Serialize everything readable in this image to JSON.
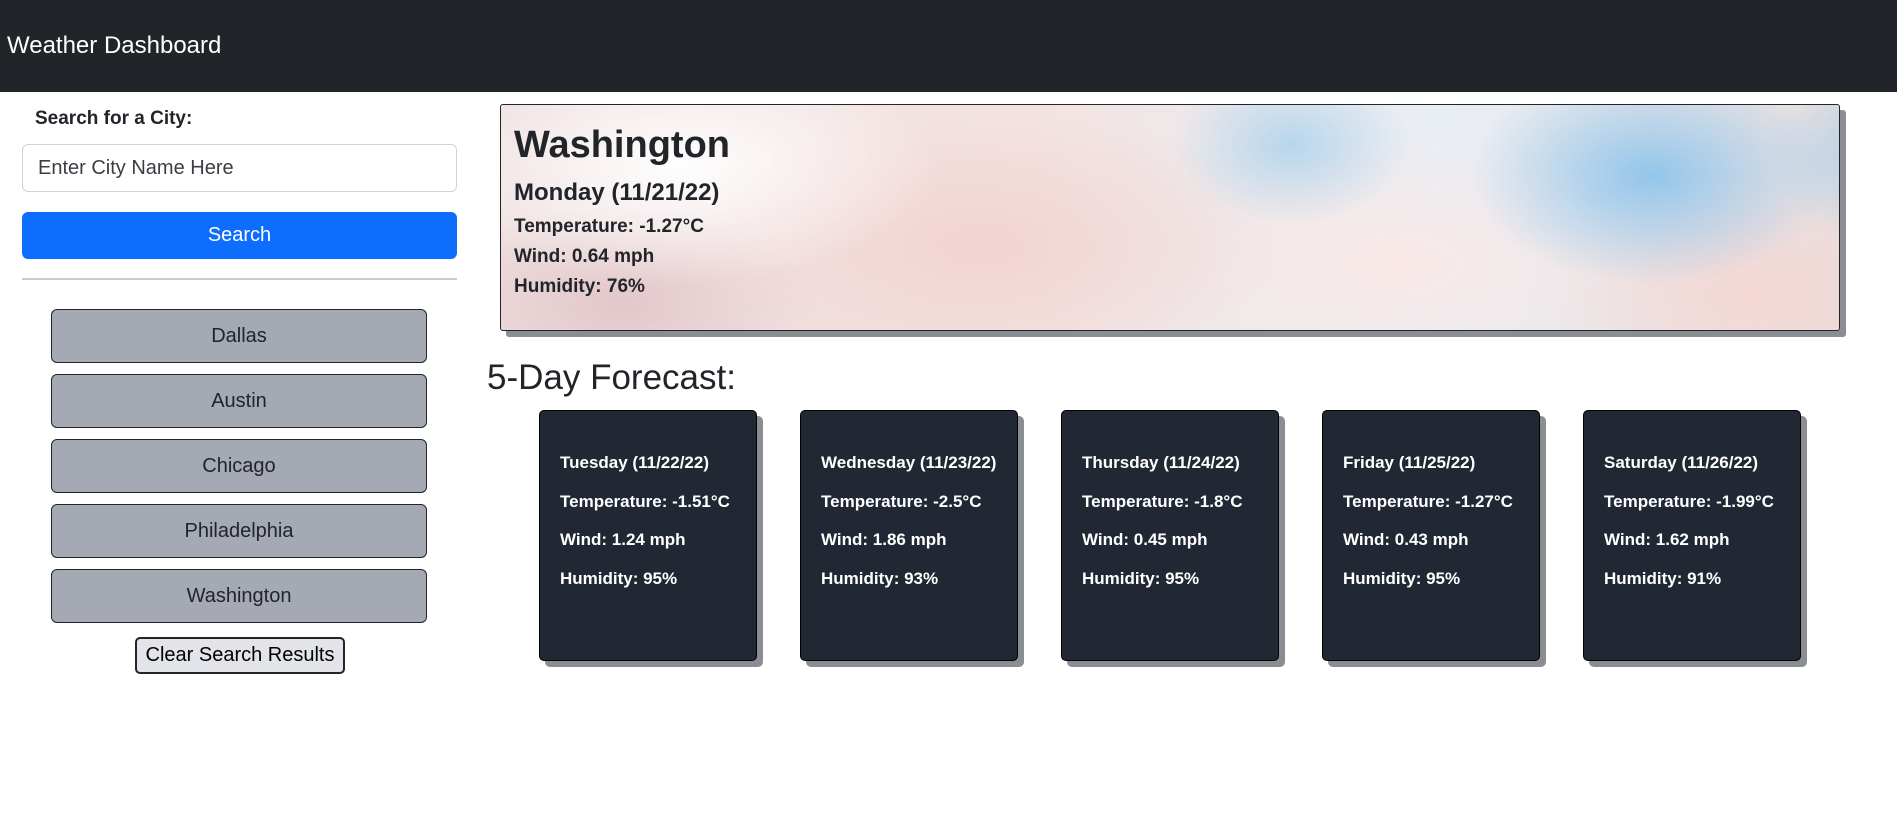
{
  "navbar": {
    "title": "Weather Dashboard"
  },
  "sidebar": {
    "search_label": "Search for a City:",
    "search_placeholder": "Enter City Name Here",
    "search_button": "Search",
    "history": [
      "Dallas",
      "Austin",
      "Chicago",
      "Philadelphia",
      "Washington"
    ],
    "clear_button": "Clear Search Results"
  },
  "current": {
    "city": "Washington",
    "date": "Monday (11/21/22)",
    "temperature": "Temperature: -1.27°C",
    "wind": "Wind: 0.64 mph",
    "humidity": "Humidity: 76%"
  },
  "forecast": {
    "title": "5-Day Forecast:",
    "days": [
      {
        "date": "Tuesday (11/22/22)",
        "temperature": "Temperature: -1.51°C",
        "wind": "Wind: 1.24 mph",
        "humidity": "Humidity: 95%"
      },
      {
        "date": "Wednesday (11/23/22)",
        "temperature": "Temperature: -2.5°C",
        "wind": "Wind: 1.86 mph",
        "humidity": "Humidity: 93%"
      },
      {
        "date": "Thursday (11/24/22)",
        "temperature": "Temperature: -1.8°C",
        "wind": "Wind: 0.45 mph",
        "humidity": "Humidity: 95%"
      },
      {
        "date": "Friday (11/25/22)",
        "temperature": "Temperature: -1.27°C",
        "wind": "Wind: 0.43 mph",
        "humidity": "Humidity: 95%"
      },
      {
        "date": "Saturday (11/26/22)",
        "temperature": "Temperature: -1.99°C",
        "wind": "Wind: 1.62 mph",
        "humidity": "Humidity: 91%"
      }
    ]
  },
  "colors": {
    "navbar_bg": "#212529",
    "search_button_bg": "#0d6efd",
    "history_button_bg": "#a5a9b4",
    "forecast_card_bg": "#212733"
  }
}
